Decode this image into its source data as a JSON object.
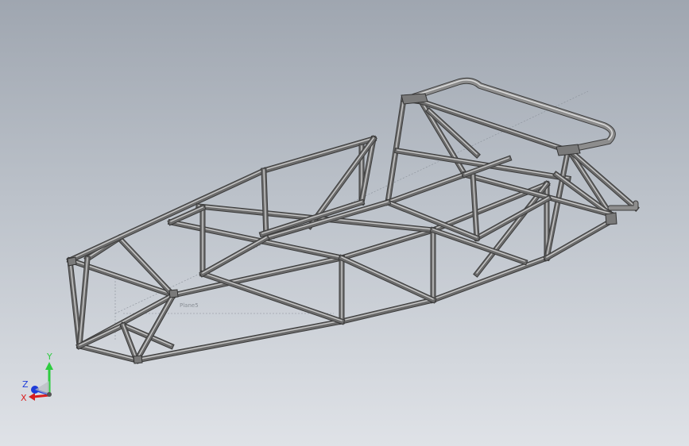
{
  "viewport": {
    "plane_label": "Plane5"
  },
  "triad": {
    "y_label": "Y",
    "z_label": "Z",
    "x_label": "X",
    "y_color": "#2ecc40",
    "x_color": "#d91e1e",
    "z_color": "#1e3cd9"
  },
  "frame": {
    "tube_color": "#6b6b6b",
    "highlight_color": "#c9c9c9",
    "shadow_color": "#3c3c3c"
  }
}
